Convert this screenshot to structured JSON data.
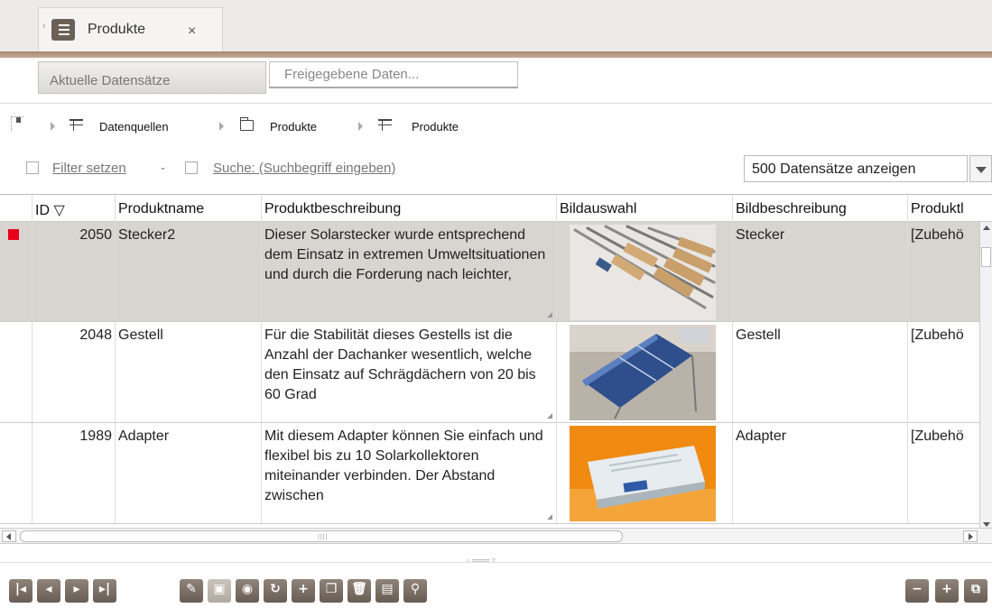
{
  "tabs": [
    {
      "label": "Produkte",
      "close": "×"
    }
  ],
  "subtabs": {
    "current": "Aktuelle Datensätze",
    "released": "Freigegebene Daten..."
  },
  "breadcrumb": [
    "Datenquellen",
    "Produkte",
    "Produkte"
  ],
  "filter": {
    "set_filter": "Filter setzen",
    "dash": "-",
    "search": "Suche: (Suchbegriff eingeben)",
    "page_size": "500 Datensätze anzeigen"
  },
  "table": {
    "headers": [
      "ID ▽",
      "Produktname",
      "Produktbeschreibung",
      "Bildauswahl",
      "Bildbeschreibung",
      "Produktl"
    ],
    "rows": [
      {
        "id": "2050",
        "name": "Stecker2",
        "description": "Dieser Solarstecker wurde entsprechend dem Einsatz in extremen Umweltsituationen und durch die Forderung nach leichter,",
        "image_desc": "Stecker",
        "category": "[Zubehö",
        "selected": true
      },
      {
        "id": "2048",
        "name": "Gestell",
        "description": "Für die Stabilität dieses Gestells ist die Anzahl der Dachanker wesentlich, welche den Einsatz auf Schrägdächern von 20 bis 60 Grad",
        "image_desc": "Gestell",
        "category": "[Zubehö",
        "selected": false
      },
      {
        "id": "1989",
        "name": "Adapter",
        "description": "Mit diesem Adapter können Sie einfach und flexibel bis zu 10 Solarkollektoren miteinander verbinden. Der Abstand zwischen",
        "image_desc": "Adapter",
        "category": "[Zubehö",
        "selected": false
      }
    ]
  },
  "colors": {
    "accent_brown": "#a88a70",
    "selected_row": "#d8d4cf",
    "marker": "#e8001a"
  }
}
